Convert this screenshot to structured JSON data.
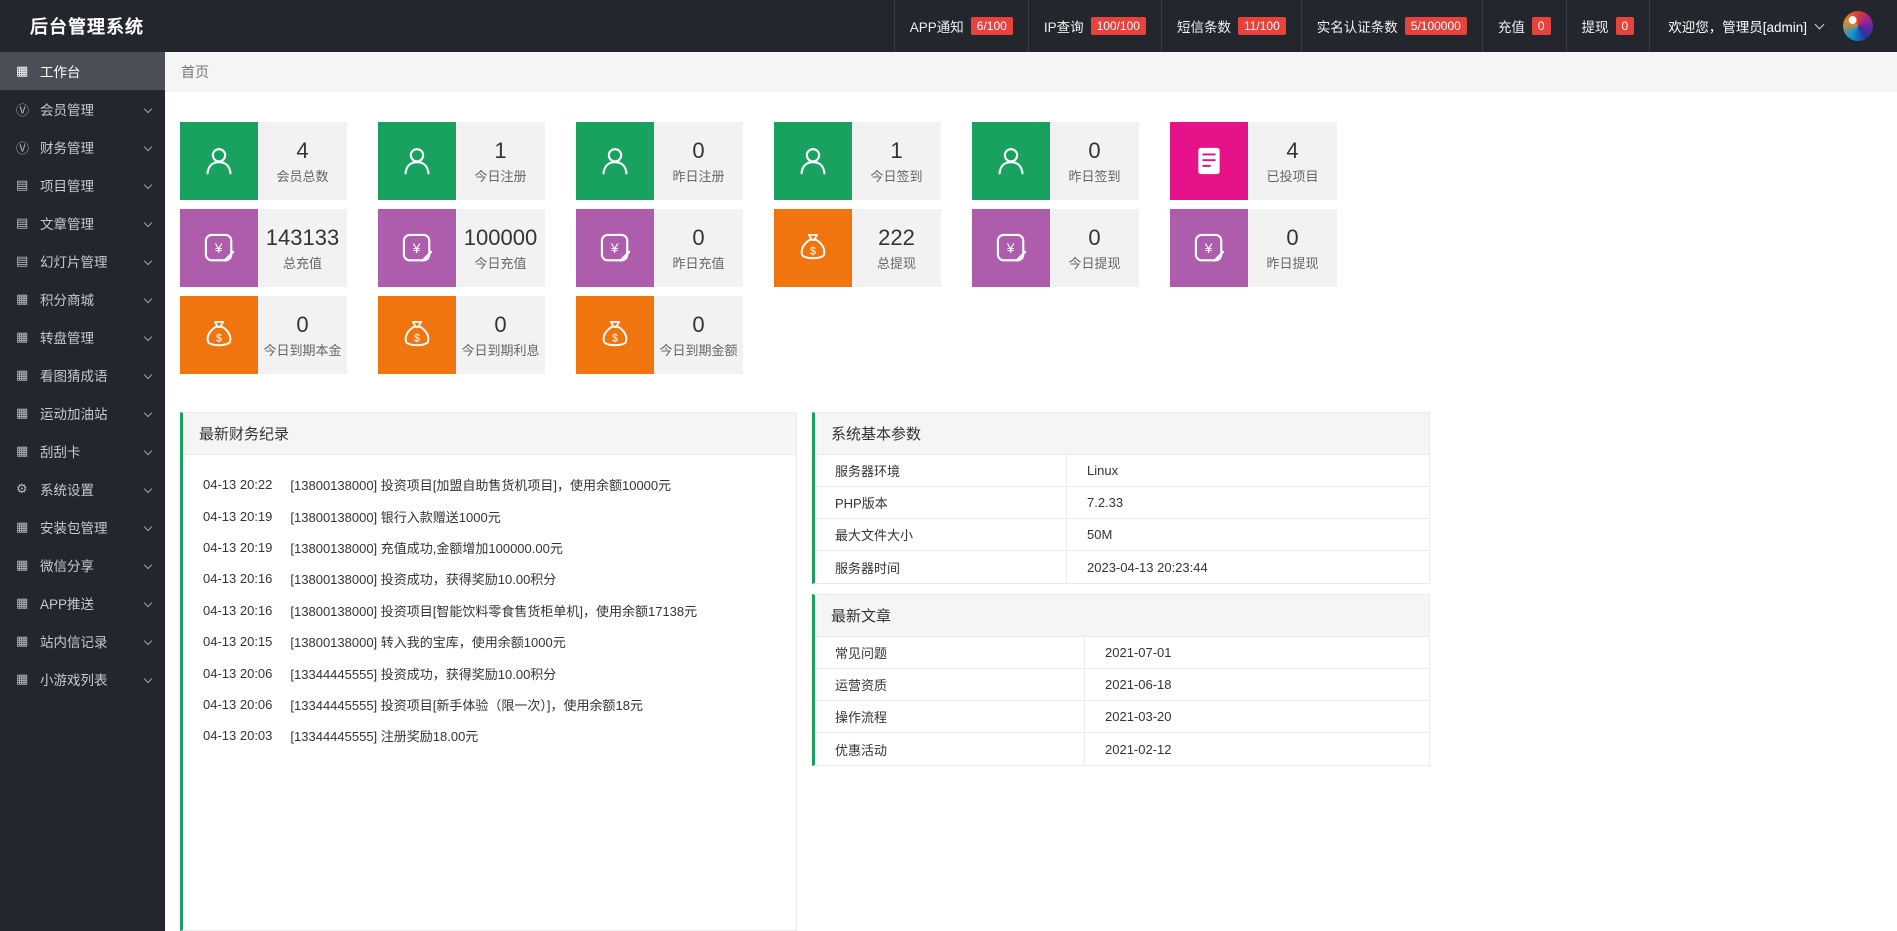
{
  "header": {
    "title": "后台管理系统",
    "stats": [
      {
        "label": "APP通知",
        "badge": "6/100"
      },
      {
        "label": "IP查询",
        "badge": "100/100"
      },
      {
        "label": "短信条数",
        "badge": "11/100"
      },
      {
        "label": "实名认证条数",
        "badge": "5/100000"
      },
      {
        "label": "充值",
        "badge": "0"
      },
      {
        "label": "提现",
        "badge": "0"
      }
    ],
    "welcome": "欢迎您，管理员[admin]"
  },
  "sidebar": [
    {
      "label": "工作台",
      "icon": "dashboard-icon",
      "active": true,
      "children": false
    },
    {
      "label": "会员管理",
      "icon": "members-icon",
      "active": false,
      "children": true
    },
    {
      "label": "财务管理",
      "icon": "finance-icon",
      "active": false,
      "children": true
    },
    {
      "label": "项目管理",
      "icon": "projects-icon",
      "active": false,
      "children": true
    },
    {
      "label": "文章管理",
      "icon": "articles-icon",
      "active": false,
      "children": true
    },
    {
      "label": "幻灯片管理",
      "icon": "slides-icon",
      "active": false,
      "children": true
    },
    {
      "label": "积分商城",
      "icon": "points-mall-icon",
      "active": false,
      "children": true
    },
    {
      "label": "转盘管理",
      "icon": "wheel-icon",
      "active": false,
      "children": true
    },
    {
      "label": "看图猜成语",
      "icon": "idiom-game-icon",
      "active": false,
      "children": true
    },
    {
      "label": "运动加油站",
      "icon": "sports-icon",
      "active": false,
      "children": true
    },
    {
      "label": "刮刮卡",
      "icon": "scratch-card-icon",
      "active": false,
      "children": true
    },
    {
      "label": "系统设置",
      "icon": "settings-icon",
      "active": false,
      "children": true
    },
    {
      "label": "安装包管理",
      "icon": "packages-icon",
      "active": false,
      "children": true
    },
    {
      "label": "微信分享",
      "icon": "wechat-share-icon",
      "active": false,
      "children": true
    },
    {
      "label": "APP推送",
      "icon": "app-push-icon",
      "active": false,
      "children": true
    },
    {
      "label": "站内信记录",
      "icon": "messages-icon",
      "active": false,
      "children": true
    },
    {
      "label": "小游戏列表",
      "icon": "mini-games-icon",
      "active": false,
      "children": true
    }
  ],
  "breadcrumb": "首页",
  "cards": [
    {
      "value": "4",
      "label": "会员总数",
      "color": "green",
      "icon": "user-icon"
    },
    {
      "value": "1",
      "label": "今日注册",
      "color": "green",
      "icon": "user-icon"
    },
    {
      "value": "0",
      "label": "昨日注册",
      "color": "green",
      "icon": "user-icon"
    },
    {
      "value": "1",
      "label": "今日签到",
      "color": "green",
      "icon": "user-icon"
    },
    {
      "value": "0",
      "label": "昨日签到",
      "color": "green",
      "icon": "user-icon"
    },
    {
      "value": "4",
      "label": "已投项目",
      "color": "magenta",
      "icon": "document-icon"
    },
    {
      "value": "143133",
      "label": "总充值",
      "color": "purple",
      "icon": "yen-icon"
    },
    {
      "value": "100000",
      "label": "今日充值",
      "color": "purple",
      "icon": "yen-icon"
    },
    {
      "value": "0",
      "label": "昨日充值",
      "color": "purple",
      "icon": "yen-icon"
    },
    {
      "value": "222",
      "label": "总提现",
      "color": "orange",
      "icon": "moneybag-icon"
    },
    {
      "value": "0",
      "label": "今日提现",
      "color": "purple",
      "icon": "yen-icon"
    },
    {
      "value": "0",
      "label": "昨日提现",
      "color": "purple",
      "icon": "yen-icon"
    },
    {
      "value": "0",
      "label": "今日到期本金",
      "color": "orange",
      "icon": "moneybag-icon"
    },
    {
      "value": "0",
      "label": "今日到期利息",
      "color": "orange",
      "icon": "moneybag-icon"
    },
    {
      "value": "0",
      "label": "今日到期金额",
      "color": "orange",
      "icon": "moneybag-icon"
    }
  ],
  "finance_panel": {
    "title": "最新财务纪录",
    "records": [
      {
        "time": "04-13 20:22",
        "text": "[13800138000] 投资项目[加盟自助售货机项目]，使用余额10000元"
      },
      {
        "time": "04-13 20:19",
        "text": "[13800138000] 银行入款赠送1000元"
      },
      {
        "time": "04-13 20:19",
        "text": "[13800138000] 充值成功,金额增加100000.00元"
      },
      {
        "time": "04-13 20:16",
        "text": "[13800138000] 投资成功，获得奖励10.00积分"
      },
      {
        "time": "04-13 20:16",
        "text": "[13800138000] 投资项目[智能饮料零食售货柜单机]，使用余额17138元"
      },
      {
        "time": "04-13 20:15",
        "text": "[13800138000] 转入我的宝库，使用余额1000元"
      },
      {
        "time": "04-13 20:06",
        "text": "[13344445555] 投资成功，获得奖励10.00积分"
      },
      {
        "time": "04-13 20:06",
        "text": "[13344445555] 投资项目[新手体验（限一次）]，使用余额18元"
      },
      {
        "time": "04-13 20:03",
        "text": "[13344445555] 注册奖励18.00元"
      }
    ]
  },
  "system_panel": {
    "title": "系统基本参数",
    "rows": [
      {
        "label": "服务器环境",
        "value": "Linux"
      },
      {
        "label": "PHP版本",
        "value": "7.2.33"
      },
      {
        "label": "最大文件大小",
        "value": "50M"
      },
      {
        "label": "服务器时间",
        "value": "2023-04-13 20:23:44"
      }
    ]
  },
  "articles_panel": {
    "title": "最新文章",
    "rows": [
      {
        "label": "常见问题",
        "value": "2021-07-01"
      },
      {
        "label": "运营资质",
        "value": "2021-06-18"
      },
      {
        "label": "操作流程",
        "value": "2021-03-20"
      },
      {
        "label": "优惠活动",
        "value": "2021-02-12"
      }
    ]
  },
  "colors": {
    "green": "#18a15f",
    "magenta": "#e6128a",
    "purple": "#ae5dad",
    "orange": "#f0750f",
    "badge_red": "#e8423d",
    "panel_accent": "#18a15f",
    "header_bg": "#23262d"
  }
}
